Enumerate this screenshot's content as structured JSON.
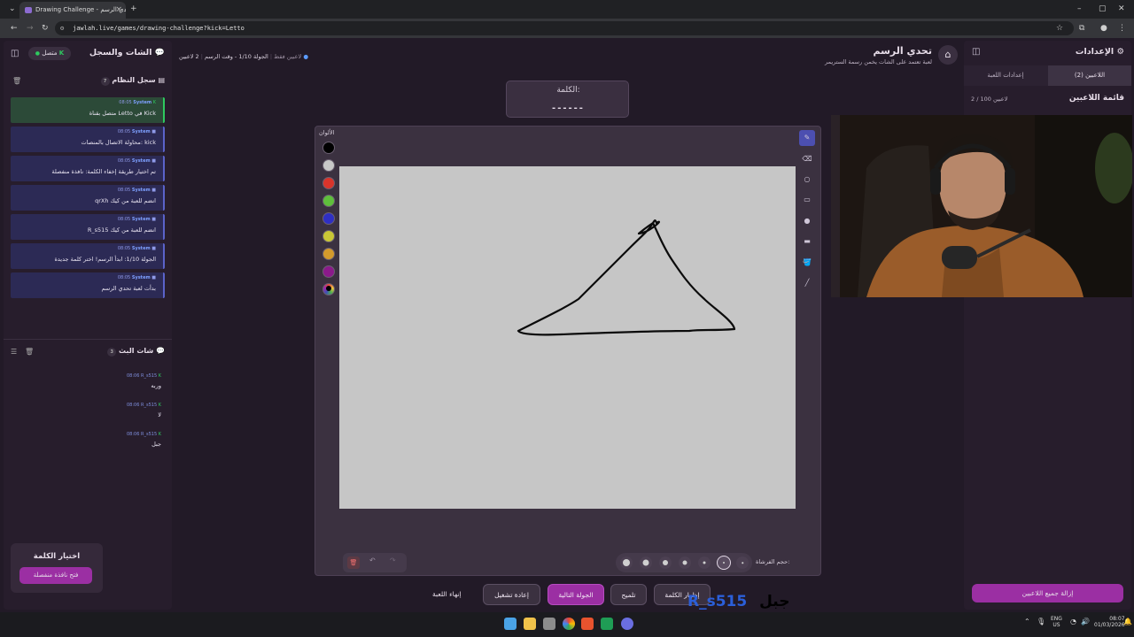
{
  "browser": {
    "tab_title": "Drawing Challenge - تحدي الرسم",
    "url": "jawlah.live/games/drawing-challenge?kick=Letto"
  },
  "left_panel": {
    "title": "الشات والسجل",
    "status": "متصل",
    "system_log_title": "سجل النظام",
    "system_log_count": "7",
    "log_entries": [
      {
        "sender": "System",
        "time": "08:05",
        "text": "متصل بقناة Letto في Kick"
      },
      {
        "sender": "System",
        "time": "08:05",
        "text": "محاولة الاتصال بالمنصات: kick"
      },
      {
        "sender": "System",
        "time": "08:05",
        "text": "تم اختيار طريقة إخفاء الكلمة: نافذة منفصلة"
      },
      {
        "sender": "System",
        "time": "08:05",
        "text": "qrXh انضم للعبة من كيك"
      },
      {
        "sender": "System",
        "time": "08:05",
        "text": "R_s515 انضم للعبة من كيك"
      },
      {
        "sender": "System",
        "time": "08:05",
        "text": "الجولة 1/10: ابدأ الرسم! اختر كلمة جديدة"
      },
      {
        "sender": "System",
        "time": "08:05",
        "text": "بدأت لعبة تحدي الرسم"
      }
    ],
    "live_chat_title": "شات البث",
    "live_chat_count": "3",
    "chat_messages": [
      {
        "user": "R_s515",
        "time": "08:06",
        "text": "وربه"
      },
      {
        "user": "R_s515",
        "time": "08:06",
        "text": "لا"
      },
      {
        "user": "R_s515",
        "time": "08:06",
        "text": "جبل"
      }
    ],
    "word_choice_title": "اختيار الكلمة",
    "word_choice_button": "فتح نافذة منفصلة"
  },
  "header": {
    "game_title": "تحدي الرسم",
    "game_subtitle": "لعبة تعتمد على الشات يخمن رسمة الستريمر",
    "players": "2 لاعبين",
    "round": "الجولة 1/10 - وقت الرسم",
    "mode": "لاعبين فقط"
  },
  "word_box": {
    "label": "الكلمة:",
    "masked": "------"
  },
  "board": {
    "colors_label": "الألوان",
    "colors": [
      "#000000",
      "#c8c8c8",
      "#d9342b",
      "#5fbf3c",
      "#2f2fc4",
      "#c9c636",
      "#d39a2c",
      "#8b1a8b"
    ],
    "brush_size_label": "حجم الفرشاة:",
    "selected_brush": 1
  },
  "footer_buttons": {
    "end_game": "إنهاء اللعبة",
    "restart": "إعادة تشغيل",
    "next_round": "الجولة التالية",
    "hint": "تلميح",
    "reveal_word": "إظهار الكلمة"
  },
  "overlay": {
    "guess_word": "جبل",
    "guess_user": "R_s515"
  },
  "right_panel": {
    "title": "الإعدادات",
    "tab_players": "اللاعبين (2)",
    "tab_settings": "إعدادات اللعبة",
    "players_list_title": "قائمة اللاعبين",
    "players_count": "2 / 100 لاعبين",
    "remove_all": "إزالة جميع اللاعبين"
  },
  "taskbar": {
    "lang": "ENG",
    "region": "US",
    "time": "08:07",
    "date": "01/03/2026"
  }
}
